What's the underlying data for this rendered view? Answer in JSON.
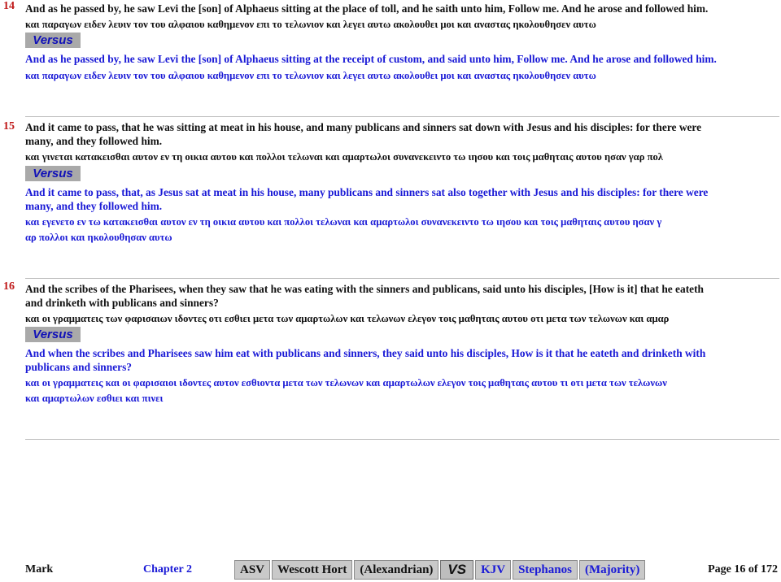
{
  "verses": [
    {
      "number": "14",
      "asv": [
        "And as he passed by, he saw Levi the [son] of Alphaeus sitting at the place of toll, and he saith unto him, Follow me. And he arose and followed him."
      ],
      "wh": [
        "και παραγων ειδεν λευιν τον του αλφαιου καθημενον επι το τελωνιον και λεγει αυτω ακολουθει μοι και αναστας ηκολουθησεν αυτω"
      ],
      "versus_label": "Versus",
      "kjv": [
        "And as he passed by, he saw Levi the [son] of Alphaeus sitting at the receipt of custom, and said unto him, Follow me. And he arose and followed him."
      ],
      "stephanos": [
        "και παραγων ειδεν λευιν τον του αλφαιου καθημενον επι το τελωνιον και λεγει αυτω ακολουθει μοι και αναστας ηκολουθησεν αυτω"
      ]
    },
    {
      "number": "15",
      "asv": [
        "And it came to pass, that he was sitting at meat in his house, and many publicans and sinners sat down with Jesus and his disciples: for there were",
        "many, and they followed him."
      ],
      "wh": [
        "και γινεται κατακεισθαι αυτον εν τη οικια αυτου και πολλοι τελωναι και αμαρτωλοι συνανεκειντο τω ιησου και τοις μαθηταις αυτου ησαν γαρ πολ"
      ],
      "versus_label": "Versus",
      "kjv": [
        "And it came to pass, that, as Jesus sat at meat in his house, many publicans and sinners sat also together with Jesus and his disciples: for there were",
        "many, and they followed him."
      ],
      "stephanos": [
        "και εγενετο εν τω κατακεισθαι αυτον εν τη οικια αυτου και πολλοι τελωναι και αμαρτωλοι συνανεκειντο τω ιησου και τοις μαθηταις αυτου ησαν γ",
        "αρ πολλοι και ηκολουθησαν αυτω"
      ]
    },
    {
      "number": "16",
      "asv": [
        "And the scribes of the Pharisees, when they saw that he was eating with the sinners and publicans, said unto his disciples, [How is it] that he eateth",
        "and drinketh with publicans and sinners?"
      ],
      "wh": [
        "και οι γραμματεις των φαρισαιων ιδοντες οτι εσθιει μετα των αμαρτωλων και τελωνων ελεγον τοις μαθηταις αυτου οτι μετα των τελωνων και αμαρ"
      ],
      "versus_label": "Versus",
      "kjv": [
        "And when the scribes and Pharisees saw him eat with publicans and sinners, they said unto his disciples, How is it that he eateth and drinketh with",
        "publicans and sinners?"
      ],
      "stephanos": [
        "και οι γραμματεις και οι φαρισαιοι ιδοντες αυτον εσθιοντα μετα των τελωνων και αμαρτωλων ελεγον τοις μαθηταις αυτου τι οτι μετα των τελωνων",
        " και αμαρτωλων εσθιει και πινει"
      ]
    }
  ],
  "footer": {
    "book": "Mark",
    "chapter": "Chapter  2",
    "nav": {
      "asv": "ASV",
      "wescott_hort": "Wescott  Hort",
      "alexandrian": "(Alexandrian)",
      "vs": "VS",
      "kjv": "KJV",
      "stephanos": "Stephanos",
      "majority": "(Majority)"
    },
    "page": "Page 16 of 172"
  },
  "colors": {
    "verse_number": "#c01a1a",
    "primary_text": "#111111",
    "compare_text": "#1a1ad6",
    "versus_bg": "#a9a9a9"
  }
}
